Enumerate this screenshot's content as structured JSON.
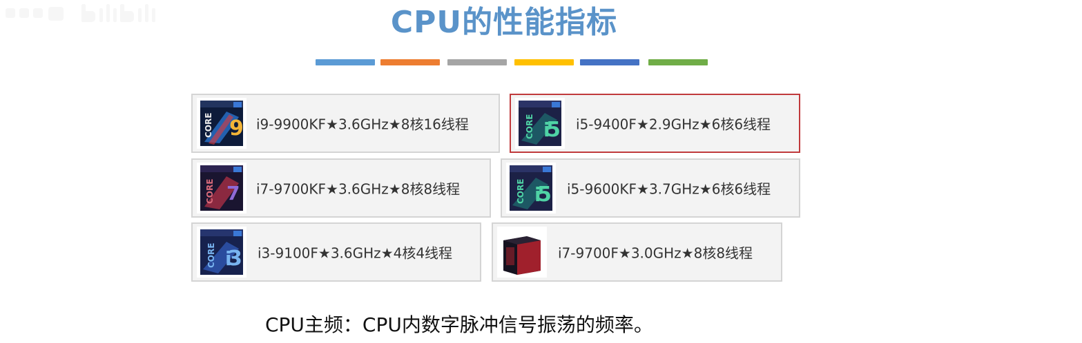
{
  "watermark": {
    "icon": "bilibili-logo-icon"
  },
  "slide": {
    "title": "CPU的性能指标",
    "accent_colors": [
      "#5b9bd5",
      "#ed7d31",
      "#a5a5a5",
      "#ffc000",
      "#4472c4",
      "#70ad47"
    ],
    "selected_border_color": "#c0393b"
  },
  "cpus": [
    {
      "label": "i9-9900KF★3.6GHz★8核16线程",
      "icon": "intel-core-i9-box-icon",
      "selected": false
    },
    {
      "label": "i5-9400F★2.9GHz★6核6线程",
      "icon": "intel-core-i5-box-icon",
      "selected": true
    },
    {
      "label": "i7-9700KF★3.6GHz★8核8线程",
      "icon": "intel-core-i7-box-icon",
      "selected": false
    },
    {
      "label": "i5-9600KF★3.7GHz★6核6线程",
      "icon": "intel-core-i5-box-icon",
      "selected": false
    },
    {
      "label": "i3-9100F★3.6GHz★4核4线程",
      "icon": "intel-core-i3-box-icon",
      "selected": false
    },
    {
      "label": "i7-9700F★3.0GHz★8核8线程",
      "icon": "intel-core-i7-box-icon",
      "selected": false
    }
  ],
  "caption": "CPU主频：CPU内数字脉冲信号振荡的频率。"
}
